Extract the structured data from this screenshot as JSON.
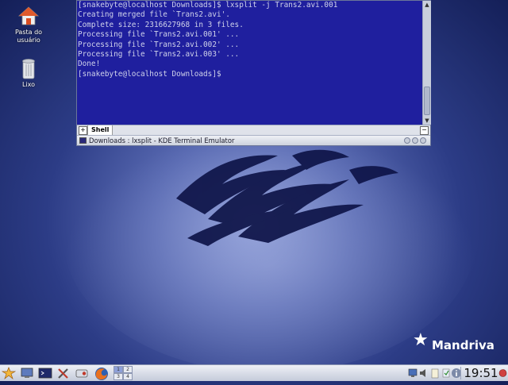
{
  "desktop": {
    "icons": [
      {
        "label": "Pasta do usuário",
        "icon": "home-folder-icon"
      },
      {
        "label": "Lixo",
        "icon": "trash-icon"
      }
    ],
    "logo_text": "Mandriva"
  },
  "terminal": {
    "lines": [
      "[snakebyte@localhost Downloads]$ lxsplit -j Trans2.avi.001",
      "Creating merged file `Trans2.avi'.",
      "Complete size: 2316627968 in 3 files.",
      "Processing file `Trans2.avi.001' ...",
      "Processing file `Trans2.avi.002' ...",
      "Processing file `Trans2.avi.003' ...",
      "Done!",
      "[snakebyte@localhost Downloads]$"
    ],
    "tab_label": "Shell",
    "window_title": "Downloads : lxsplit - KDE Terminal Emulator",
    "colors": {
      "background": "#1f1f9e",
      "text": "#cfd2ea"
    }
  },
  "taskbar": {
    "launchers": [
      "start-menu-icon",
      "computer-icon",
      "terminal-icon",
      "tools-icon",
      "disk-icon",
      "firefox-icon"
    ],
    "pager": [
      "1",
      "2",
      "3",
      "4"
    ],
    "tray": [
      "network-icon",
      "volume-icon",
      "clipboard-icon",
      "update-icon",
      "info-icon"
    ],
    "clock": "19:51"
  }
}
